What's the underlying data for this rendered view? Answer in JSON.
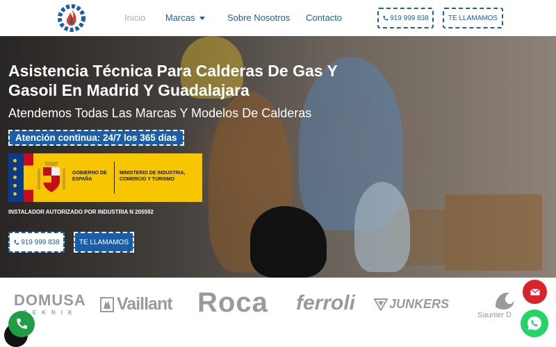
{
  "header": {
    "logo_icon": "flame-gear-logo-icon",
    "nav": [
      {
        "label": "Inicio"
      },
      {
        "label": "Marcas"
      },
      {
        "label": "Sobre Nosotros"
      },
      {
        "label": "Contacto"
      }
    ],
    "phone_label": "919 999 838",
    "call_label": "TE LLAMAMOS"
  },
  "hero": {
    "title": "Asistencia Técnica Para Calderas De Gas Y Gasoil En Madrid Y Guadalajara",
    "subtitle": "Atendemos Todas Las Marcas Y Modelos De Calderas",
    "badge": "Atención continua: 24/7 los 365 días",
    "gov_left": "GOBIERNO DE ESPAÑA",
    "gov_right": "MINISTERIO DE INDUSTRIA, COMERCIO Y TURISMO",
    "installer_note": "INSTALADOR AUTORIZADO POR INDUSTRIA N 205592",
    "phone_label": "919 999 838",
    "call_label": "TE LLAMAMOS"
  },
  "brands": [
    {
      "name": "DOMUSA",
      "sub": "TEKNIK"
    },
    {
      "name": "Vaillant"
    },
    {
      "name": "Roca"
    },
    {
      "name": "ferroli"
    },
    {
      "name": "JUNKERS"
    },
    {
      "name": "Saunier D"
    }
  ],
  "colors": {
    "brand_blue": "#1a5ea8",
    "mail_red": "#d9232a",
    "whatsapp_green": "#25d366",
    "gov_yellow": "#f7c600"
  }
}
